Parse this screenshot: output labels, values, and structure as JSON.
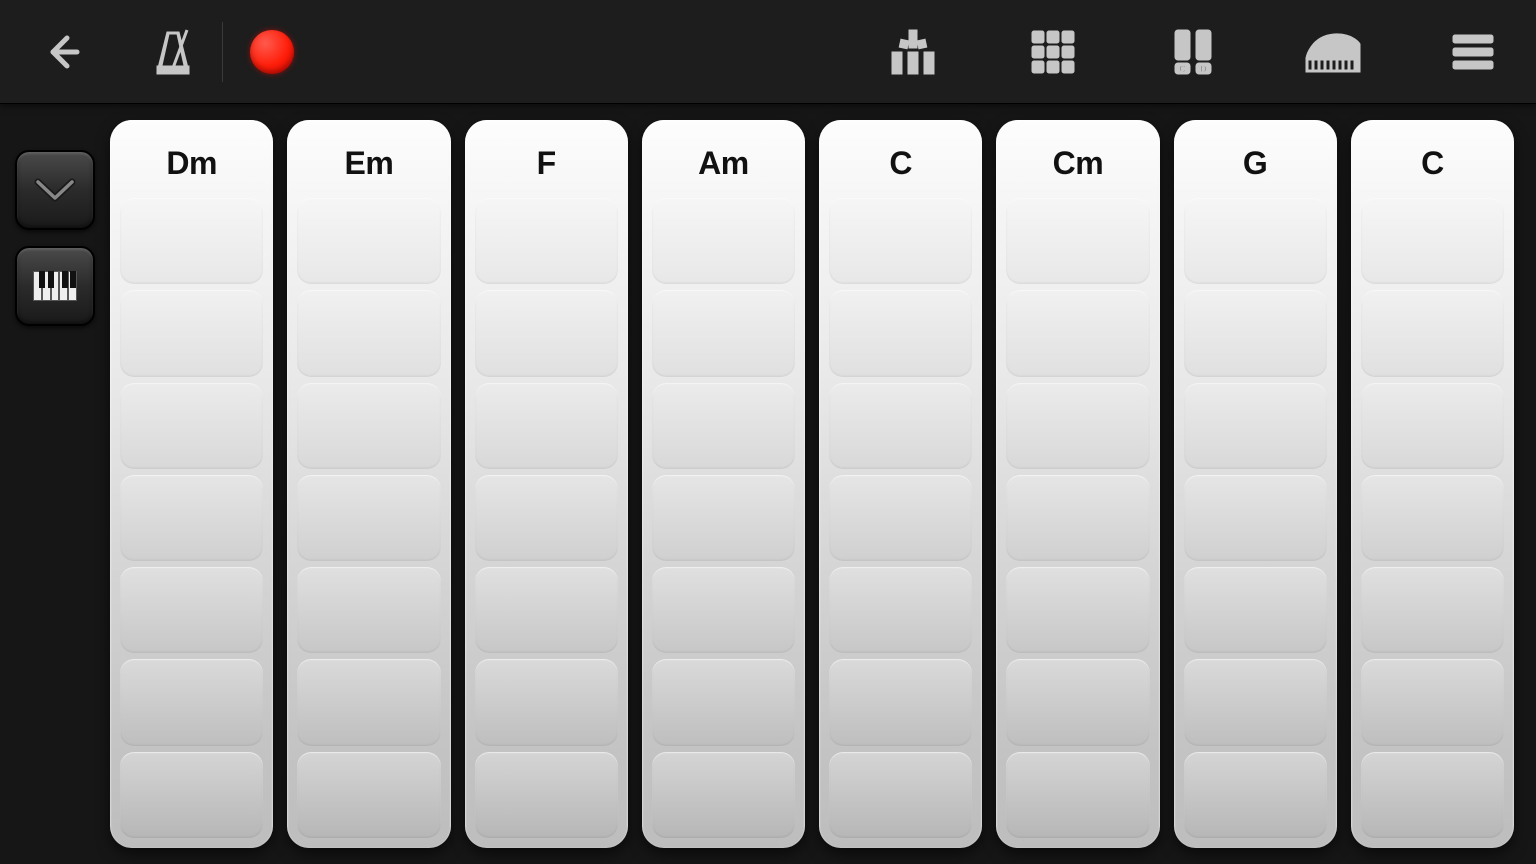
{
  "toolbar": {
    "icons": {
      "back": "back-arrow",
      "metronome": "metronome",
      "record": "record",
      "arpeggiator": "arpeggiator",
      "grid": "pad-grid",
      "chord_pads": "chord-pads",
      "keyboard_instrument": "keyboard-instrument",
      "menu": "menu"
    }
  },
  "side": {
    "collapse": "chevron-down",
    "keyboard": "keyboard"
  },
  "chords": [
    "Dm",
    "Em",
    "F",
    "Am",
    "C",
    "Cm",
    "G",
    "C"
  ],
  "segments_per_chord": 7
}
